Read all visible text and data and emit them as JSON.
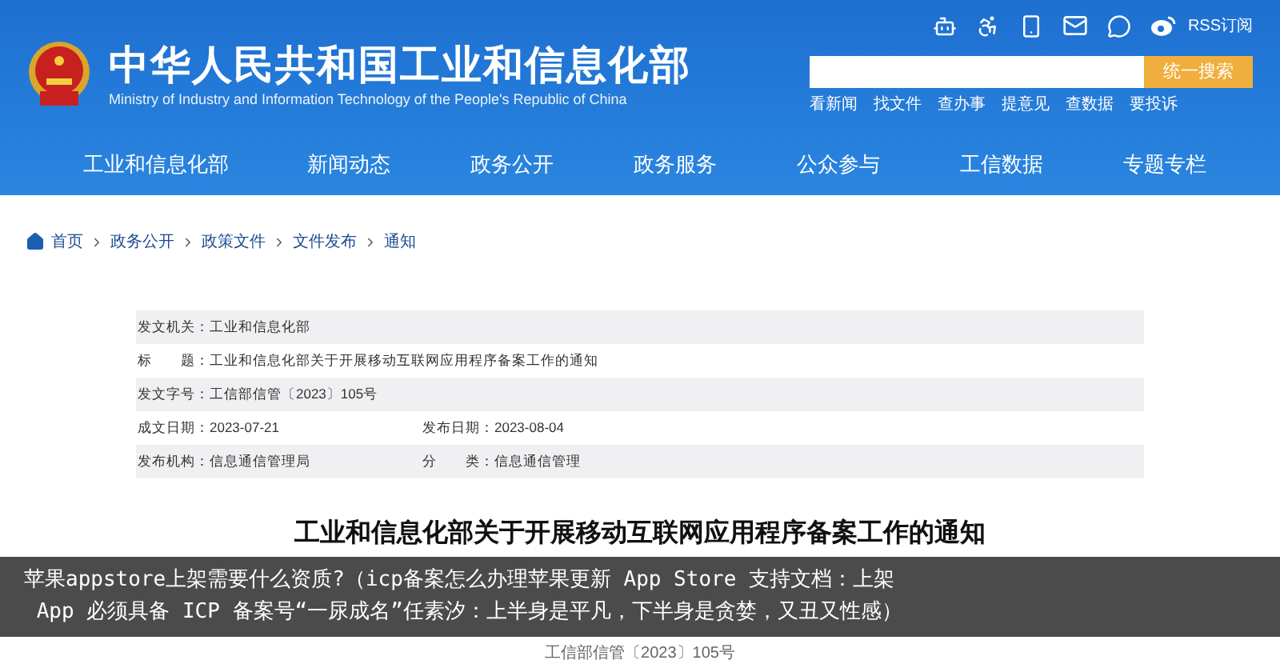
{
  "header": {
    "title": "中华人民共和国工业和信息化部",
    "subtitle": "Ministry of Industry and Information Technology of the People's Republic of China",
    "rss": "RSS订阅",
    "search": {
      "button": "统一搜索"
    },
    "quick_links": [
      "看新闻",
      "找文件",
      "查办事",
      "提意见",
      "查数据",
      "要投诉"
    ]
  },
  "nav": {
    "items": [
      "工业和信息化部",
      "新闻动态",
      "政务公开",
      "政务服务",
      "公众参与",
      "工信数据",
      "专题专栏"
    ]
  },
  "breadcrumb": [
    "首页",
    "政务公开",
    "政策文件",
    "文件发布",
    "通知"
  ],
  "meta": {
    "rows": [
      {
        "cells": [
          {
            "label": "发文机关：",
            "value": "工业和信息化部"
          }
        ]
      },
      {
        "cells": [
          {
            "label": "标　　题：",
            "value": "工业和信息化部关于开展移动互联网应用程序备案工作的通知"
          }
        ]
      },
      {
        "cells": [
          {
            "label": "发文字号：",
            "value": "工信部信管〔2023〕105号"
          }
        ]
      },
      {
        "cells": [
          {
            "label": "成文日期：",
            "value": "2023-07-21"
          },
          {
            "label": "发布日期：",
            "value": "2023-08-04"
          }
        ]
      },
      {
        "cells": [
          {
            "label": "发布机构：",
            "value": "信息通信管理局"
          },
          {
            "label": "分　　类：",
            "value": "信息通信管理"
          }
        ]
      }
    ]
  },
  "document": {
    "title": "工业和信息化部关于开展移动互联网应用程序备案工作的通知",
    "number": "工信部信管〔2023〕105号"
  },
  "caption": {
    "lines": [
      "苹果appstore上架需要什么资质?（icp备案怎么办理苹果更新 App Store 支持文档：上架",
      " App 必须具备 ICP 备案号“一尿成名”任素汐：上半身是平凡，下半身是贪婪，又丑又性感）"
    ]
  }
}
